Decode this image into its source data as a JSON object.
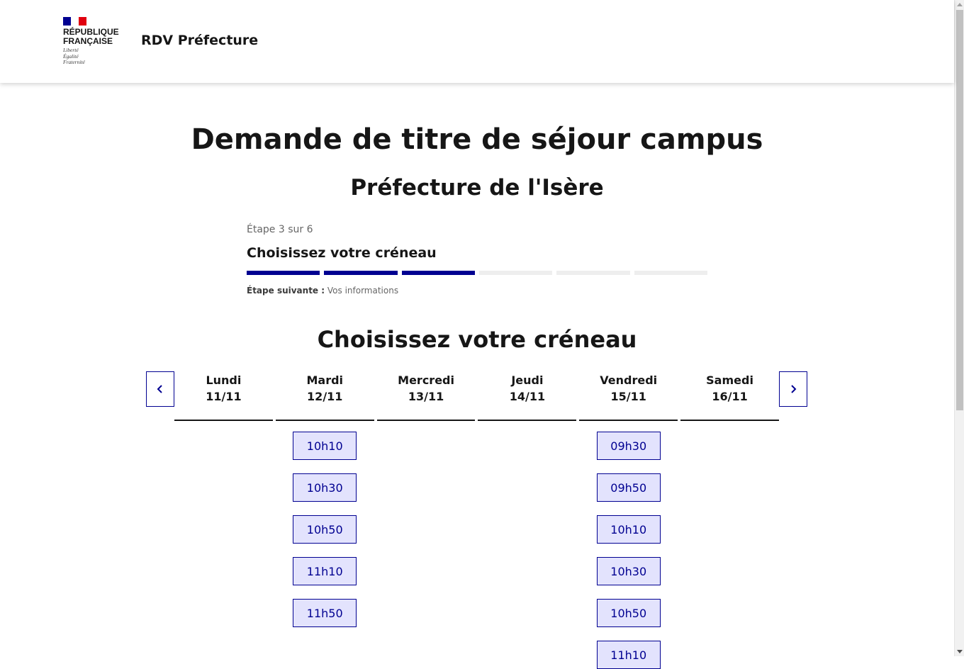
{
  "header": {
    "logo_line1": "RÉPUBLIQUE",
    "logo_line2": "FRANÇAISE",
    "motto_1": "Liberté",
    "motto_2": "Égalité",
    "motto_3": "Fraternité",
    "service_name": "RDV Préfecture",
    "flag_colors": [
      "#000091",
      "#ffffff",
      "#e1000f"
    ]
  },
  "main": {
    "title": "Demande de titre de séjour campus",
    "subtitle": "Préfecture de l'Isère"
  },
  "stepper": {
    "state": "Étape 3 sur 6",
    "current": 3,
    "total": 6,
    "title": "Choisissez votre créneau",
    "next_label": "Étape suivante :",
    "next_value": "Vos informations"
  },
  "calendar": {
    "title": "Choisissez votre créneau",
    "prev_icon": "chevron-left-icon",
    "next_icon": "chevron-right-icon",
    "days": [
      {
        "name": "Lundi",
        "date": "11/11",
        "slots": []
      },
      {
        "name": "Mardi",
        "date": "12/11",
        "slots": [
          "10h10",
          "10h30",
          "10h50",
          "11h10",
          "11h50"
        ]
      },
      {
        "name": "Mercredi",
        "date": "13/11",
        "slots": []
      },
      {
        "name": "Jeudi",
        "date": "14/11",
        "slots": []
      },
      {
        "name": "Vendredi",
        "date": "15/11",
        "slots": [
          "09h30",
          "09h50",
          "10h10",
          "10h30",
          "10h50",
          "11h10"
        ]
      },
      {
        "name": "Samedi",
        "date": "16/11",
        "slots": []
      }
    ]
  },
  "colors": {
    "accent": "#000091",
    "slot_bg": "#e3e3fd",
    "step_inactive": "#eeeeee"
  }
}
